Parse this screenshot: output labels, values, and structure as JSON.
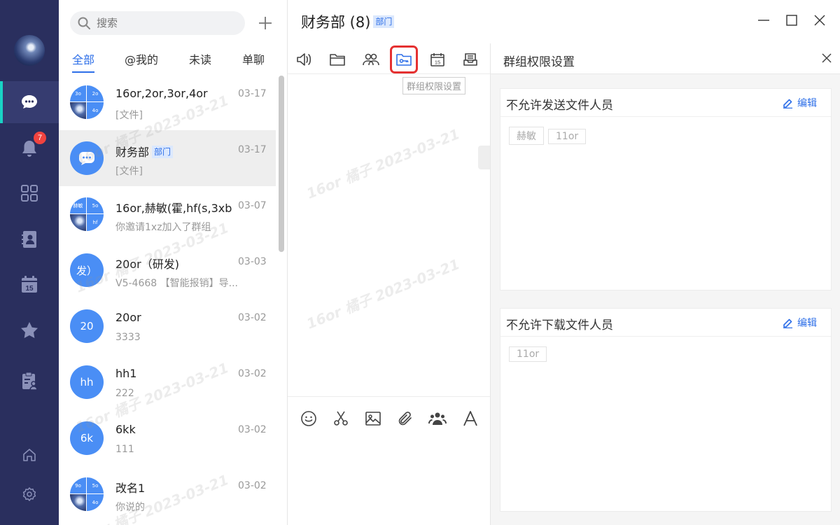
{
  "nav": {
    "badge_count": "7",
    "items": [
      "chat-icon",
      "bell-icon",
      "apps-icon",
      "contacts-icon",
      "calendar-icon",
      "star-icon",
      "clipboard-user-icon",
      "home-icon",
      "settings-icon"
    ]
  },
  "search": {
    "placeholder": "搜索"
  },
  "filter_tabs": [
    "全部",
    "@我的",
    "未读",
    "单聊"
  ],
  "conversations": [
    {
      "name": "16or,2or,3or,4or",
      "date": "03-17",
      "preview": "[文件]",
      "avatar_quads": [
        "3o",
        "2o",
        "",
        "4o"
      ]
    },
    {
      "name": "财务部",
      "tag": "部门",
      "date": "03-17",
      "preview": "[文件]"
    },
    {
      "name": "16or,赫敏(霍,hf(s,3xb",
      "date": "03-07",
      "preview": "你邀请1xz加入了群组",
      "avatar_quads": [
        "赫敏",
        "5o",
        "",
        "hf"
      ]
    },
    {
      "name": "20or（研发)",
      "date": "03-03",
      "preview": "V5-4668 【智能报销】导...",
      "avatar_text": "发）"
    },
    {
      "name": "20or",
      "date": "03-02",
      "preview": "3333",
      "avatar_text": "20"
    },
    {
      "name": "hh1",
      "date": "03-02",
      "preview": "222",
      "avatar_text": "hh"
    },
    {
      "name": "6kk",
      "date": "03-02",
      "preview": "111",
      "avatar_text": "6k"
    },
    {
      "name": "改名1",
      "date": "03-02",
      "preview": "你说的",
      "avatar_quads": [
        "9o",
        "5o",
        "",
        "4o"
      ]
    }
  ],
  "chat": {
    "title": "财务部 (8)",
    "tag": "部门",
    "tooltip": "群组权限设置"
  },
  "panel": {
    "title": "群组权限设置",
    "cards": [
      {
        "title": "不允许发送文件人员",
        "edit_label": "编辑",
        "members": [
          "赫敏",
          "11or"
        ]
      },
      {
        "title": "不允许下载文件人员",
        "edit_label": "编辑",
        "members": [
          "11or"
        ]
      }
    ]
  },
  "watermark": "16or 橘子 2023-03-21",
  "colors": {
    "nav_bg": "#2a2f5e",
    "accent": "#2e6fe8",
    "active_bar": "#19d3c5",
    "highlight": "#e53131",
    "badge": "#f0433f"
  }
}
